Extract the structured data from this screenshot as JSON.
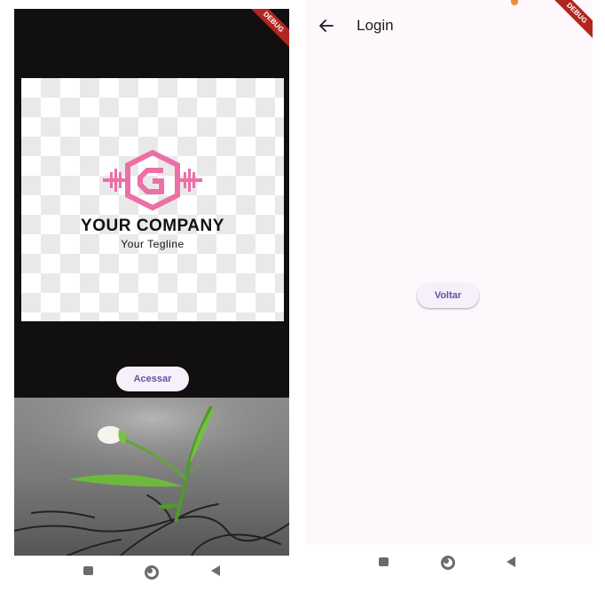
{
  "colors": {
    "accent_pink": "#ec6fa7",
    "button_text": "#6a4ea1",
    "button_bg": "#f6f0fa",
    "dark_bg": "#120f10",
    "light_bg": "#fef7fb",
    "debug_banner": "#b3261e"
  },
  "left_screen": {
    "debug_label": "DEBUG",
    "logo": {
      "icon": "barbell-g-hexagon-icon",
      "company_name": "YOUR COMPANY",
      "tagline": "Your Tegline"
    },
    "button_label": "Acessar",
    "photo": "sprout-through-asphalt-image",
    "nav": [
      "square-recents-icon",
      "circle-home-icon",
      "triangle-back-icon"
    ]
  },
  "right_screen": {
    "debug_label": "DEBUG",
    "appbar": {
      "back_icon": "arrow-left-icon",
      "title": "Login"
    },
    "button_label": "Voltar",
    "nav": [
      "square-recents-icon",
      "circle-home-icon",
      "triangle-back-icon"
    ]
  }
}
